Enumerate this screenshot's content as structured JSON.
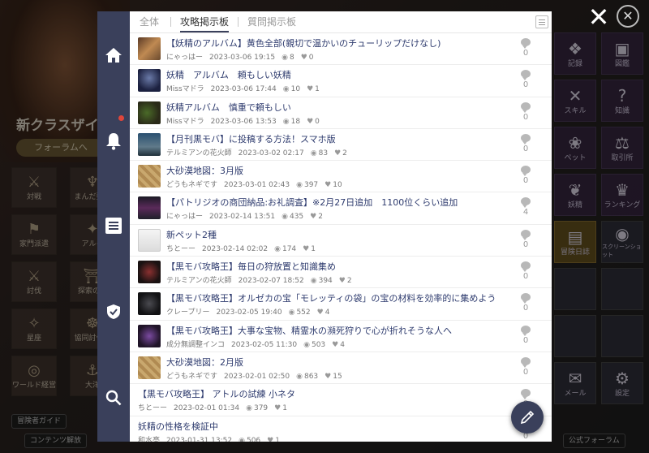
{
  "background": {
    "promo_title": "新クラスザイ",
    "promo_button": "フォーラムへ",
    "left_tiles": [
      {
        "label": "対戦",
        "glyph": "⚔"
      },
      {
        "label": "まんだ要塞",
        "glyph": "♆"
      },
      {
        "label": "家門派遣",
        "glyph": "⚑"
      },
      {
        "label": "アルイ",
        "glyph": "✦"
      },
      {
        "label": "討伐",
        "glyph": "⚔"
      },
      {
        "label": "探索の門",
        "glyph": "⛩"
      },
      {
        "label": "星座",
        "glyph": "✧"
      },
      {
        "label": "協同討伐隊",
        "glyph": "☸"
      },
      {
        "label": "ワールド経営",
        "glyph": "◎"
      },
      {
        "label": "大洋",
        "glyph": "⚓"
      }
    ],
    "right_tiles": [
      {
        "label": "記録",
        "glyph": "❖"
      },
      {
        "label": "図鑑",
        "glyph": "▣"
      },
      {
        "label": "スキル",
        "glyph": "✕"
      },
      {
        "label": "知識",
        "glyph": "?"
      },
      {
        "label": "ペット",
        "glyph": "❀"
      },
      {
        "label": "取引所",
        "glyph": "⚖"
      },
      {
        "label": "妖精",
        "glyph": "❦"
      },
      {
        "label": "ランキング",
        "glyph": "♛"
      },
      {
        "label": "冒険日誌",
        "glyph": "▤"
      },
      {
        "label": "スクリーンショット",
        "glyph": "◉"
      },
      {
        "label": "",
        "glyph": ""
      },
      {
        "label": "",
        "glyph": ""
      },
      {
        "label": "",
        "glyph": ""
      },
      {
        "label": "",
        "glyph": ""
      },
      {
        "label": "メール",
        "glyph": "✉"
      },
      {
        "label": "設定",
        "glyph": "⚙"
      }
    ],
    "bottom_left_1": "冒険者ガイド",
    "bottom_left_2": "コンテンツ解放",
    "bottom_right": "公式フォーラム"
  },
  "tabs": [
    {
      "label": "全体",
      "active": false
    },
    {
      "label": "攻略掲示板",
      "active": true
    },
    {
      "label": "質問掲示板",
      "active": false
    }
  ],
  "posts": [
    {
      "title": "【妖精のアルバム】黄色全部(親切で温かいのチューリップだけなし)",
      "author": "にゃっはー",
      "date": "2023-03-06 19:15",
      "views": "8",
      "likes": "0",
      "comments": "0",
      "thumb": "th-brown"
    },
    {
      "title": "妖精　アルバム　頼もしい妖精",
      "author": "Missマドラ",
      "date": "2023-03-06 17:44",
      "views": "10",
      "likes": "1",
      "comments": "0",
      "thumb": "th-dark"
    },
    {
      "title": "妖精アルバム　慎重で頼もしい",
      "author": "Missマドラ",
      "date": "2023-03-06 13:53",
      "views": "18",
      "likes": "0",
      "comments": "0",
      "thumb": "th-plant"
    },
    {
      "title": "【月刊黒モバ】に投稿する方法！スマホ版",
      "author": "テルミアンの花火師",
      "date": "2023-03-02 02:17",
      "views": "83",
      "likes": "2",
      "comments": "0",
      "thumb": "th-sky"
    },
    {
      "title": "大砂漠地図：3月版",
      "author": "どうもネギです",
      "date": "2023-03-01 02:43",
      "views": "397",
      "likes": "10",
      "comments": "0",
      "thumb": "th-sand"
    },
    {
      "title": "【パトリジオの商団納品:お礼調査】※2月27日追加　1100位くらい追加",
      "author": "にゃっはー",
      "date": "2023-02-14 13:51",
      "views": "435",
      "likes": "2",
      "comments": "4",
      "thumb": "th-shop"
    },
    {
      "title": "新ペット2種",
      "author": "ちとーー",
      "date": "2023-02-14 02:02",
      "views": "174",
      "likes": "1",
      "comments": "0",
      "thumb": "th-paper"
    },
    {
      "title": "【黒モバ攻略王】毎日の狩放置と知識集め",
      "author": "テルミアンの花火師",
      "date": "2023-02-07 18:52",
      "views": "394",
      "likes": "2",
      "comments": "0",
      "thumb": "th-battle"
    },
    {
      "title": "【黒モバ攻略王】オルゼカの宝「モレッティの袋」の宝の材料を効率的に集めよう",
      "author": "クレープリー",
      "date": "2023-02-05 19:40",
      "views": "552",
      "likes": "4",
      "comments": "0",
      "thumb": "th-gloom"
    },
    {
      "title": "【黒モバ攻略王】大事な宝物、精霊水の瀕死狩りで心が折れそうな人へ",
      "author": "成分無調整インコ",
      "date": "2023-02-05 11:30",
      "views": "503",
      "likes": "4",
      "comments": "0",
      "thumb": "th-fire"
    },
    {
      "title": "大砂漠地図：2月版",
      "author": "どうもネギです",
      "date": "2023-02-01 02:50",
      "views": "863",
      "likes": "15",
      "comments": "0",
      "thumb": "th-sand"
    },
    {
      "title": "【黒モバ攻略王】 アトルの試練 小ネタ",
      "author": "ちとーー",
      "date": "2023-02-01 01:34",
      "views": "379",
      "likes": "1",
      "comments": "0",
      "thumb": ""
    },
    {
      "title": "妖精の性格を検証中",
      "author": "和水亮",
      "date": "2023-01-31 13:52",
      "views": "506",
      "likes": "1",
      "comments": "0",
      "thumb": ""
    }
  ],
  "icons": {
    "views": "◉",
    "likes": "♥"
  },
  "colors": {
    "sidebar": "#3a405b",
    "title_link": "#2e3b6e",
    "notification_dot": "#e0463b"
  }
}
